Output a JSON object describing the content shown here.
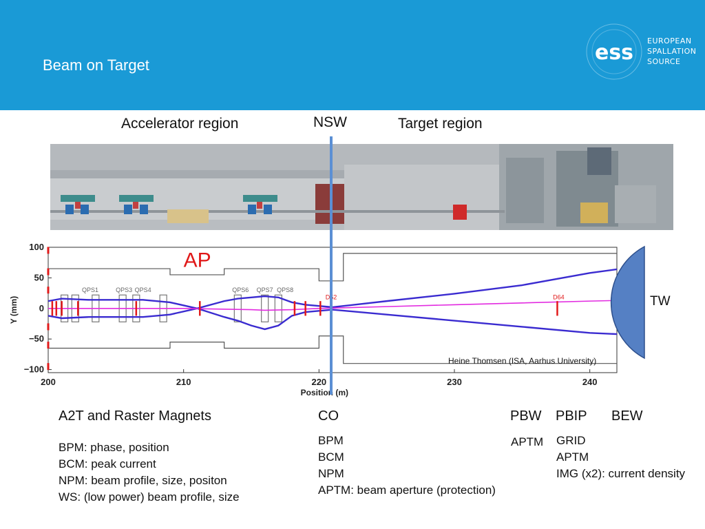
{
  "slide": {
    "title": "Beam on Target"
  },
  "logo": {
    "line1": "EUROPEAN",
    "line2": "SPALLATION",
    "line3": "SOURCE",
    "mark": "ess"
  },
  "regions": {
    "accelerator": "Accelerator region",
    "nsw": "NSW",
    "target": "Target region"
  },
  "colors": {
    "header": "#1a9ad6",
    "beam_envelope": "#3a2bd0",
    "centroid": "#e22ae0",
    "markers": "#e21a1a",
    "nsw_line": "#5b8fd4",
    "target_wheel": "#5580c4"
  },
  "chart_data": {
    "type": "line",
    "title": "AP",
    "xlabel": "Position (m)",
    "ylabel": "Y (mm)",
    "xlim": [
      200,
      242
    ],
    "ylim": [
      -105,
      100
    ],
    "x_ticks": [
      "200",
      "210",
      "220",
      "230",
      "240"
    ],
    "y_ticks": [
      "100",
      "50",
      "0",
      "−50",
      "−100"
    ],
    "grid": false,
    "magnet_labels": [
      "QPS1",
      "QPS3",
      "QPS4",
      "QPS6",
      "QPS7",
      "QPS8"
    ],
    "marker_labels": [
      "D52",
      "D64"
    ],
    "series": [
      {
        "x": [
          200,
          201,
          203,
          205,
          207,
          209,
          211,
          213,
          214,
          215,
          216,
          217,
          218,
          219,
          220,
          221,
          225,
          230,
          235,
          240,
          242
        ],
        "values": [
          12,
          16,
          14,
          14,
          14,
          10,
          0,
          -14,
          -20,
          -28,
          -34,
          -28,
          -12,
          -6,
          -4,
          -2,
          -10,
          -20,
          -30,
          -40,
          -42
        ]
      },
      {
        "x": [
          200,
          201,
          203,
          205,
          207,
          209,
          211,
          213,
          214,
          215,
          216,
          217,
          218,
          219,
          220,
          221,
          225,
          230,
          235,
          240,
          242
        ],
        "values": [
          -12,
          -16,
          -14,
          -14,
          -14,
          -10,
          0,
          12,
          16,
          18,
          20,
          18,
          10,
          6,
          4,
          2,
          12,
          24,
          38,
          58,
          64
        ]
      },
      {
        "x": [
          200,
          205,
          210,
          215,
          216,
          218,
          220,
          225,
          230,
          235,
          240,
          242
        ],
        "values": [
          0,
          0,
          0,
          -2,
          -3,
          -2,
          0,
          3,
          6,
          9,
          12,
          13
        ]
      }
    ],
    "credit": "Heine Thomsen (ISA, Aarhus University)",
    "target_label": "TW"
  },
  "sections": {
    "a2t": {
      "title": "A2T and Raster Magnets",
      "items": [
        "BPM: phase, position",
        "BCM: peak current",
        "NPM: beam profile, size, positon",
        "WS: (low power) beam profile, size"
      ]
    },
    "co": {
      "title": "CO",
      "items": [
        "BPM",
        "BCM",
        "NPM",
        "APTM: beam aperture (protection)"
      ]
    },
    "pbw": {
      "title": "PBW",
      "items": [
        "APTM"
      ]
    },
    "pbip": {
      "title": "PBIP",
      "items": [
        "GRID",
        "APTM",
        "IMG (x2): current density"
      ]
    },
    "bew": {
      "title": "BEW"
    }
  }
}
